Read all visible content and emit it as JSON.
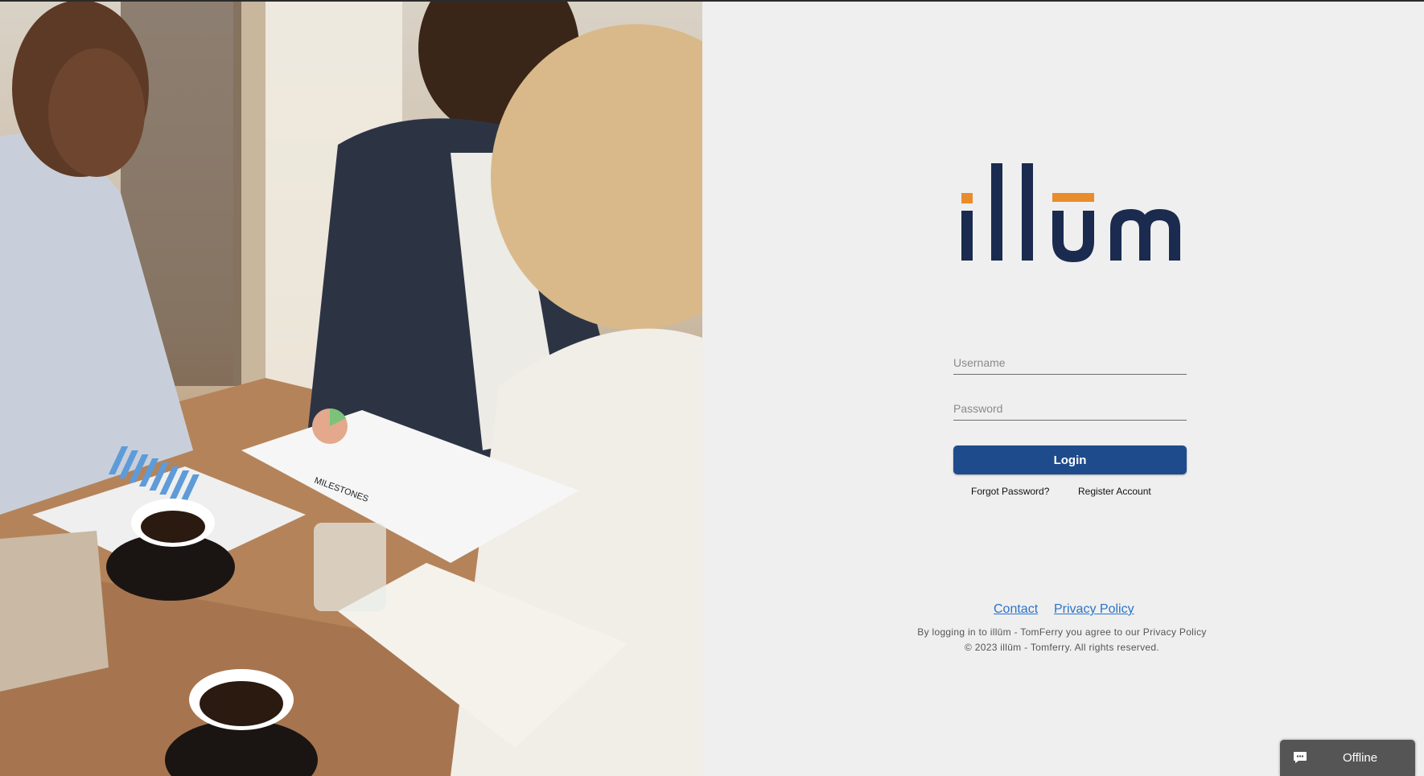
{
  "brand": {
    "logo_text": "illūm",
    "colors": {
      "navy": "#1b2b4f",
      "orange": "#e98c2c",
      "button": "#1e4b8b",
      "link": "#2b74c7"
    }
  },
  "form": {
    "username_placeholder": "Username",
    "password_placeholder": "Password",
    "login_label": "Login",
    "forgot_label": "Forgot Password?",
    "register_label": "Register Account"
  },
  "footer": {
    "contact_label": "Contact",
    "privacy_label": "Privacy Policy",
    "agreement": "By logging in to illūm - TomFerry you agree to our Privacy Policy",
    "copyright": "© 2023 illūm - Tomferry. All rights reserved."
  },
  "chat_widget": {
    "icon": "chat-bubble-icon",
    "status": "Offline"
  },
  "hero_image": {
    "paper_heading": "MILESTONES"
  }
}
